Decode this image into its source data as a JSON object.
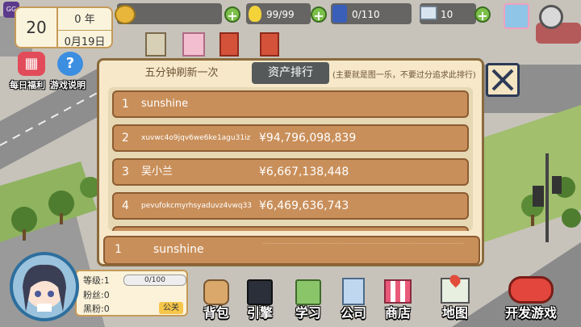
{
  "game": {
    "top_bar": {
      "money_value": "",
      "energy_value": "99/99",
      "fans_value": "0/110",
      "computers_value": "10",
      "day": "20",
      "year_label": "0 年",
      "date_label": "0月19日"
    },
    "side_buttons": {
      "daily_welfare_label": "每日福利",
      "game_help_label": "游戏说明"
    },
    "ranking_panel": {
      "tab_refresh_label": "五分钟刷新一次",
      "tab_asset_label": "资产排行",
      "note": "(主要就是图一乐，不要过分追求此排行)",
      "rows": [
        {
          "rank": "1",
          "name": "sunshine",
          "value": ""
        },
        {
          "rank": "2",
          "name": "xuvwc4o9jqv6we6ke1agu31iz",
          "value": "¥94,796,098,839"
        },
        {
          "rank": "3",
          "name": "吴小兰",
          "value": "¥6,667,138,448"
        },
        {
          "rank": "4",
          "name": "pevufokcmyrhsyaduvz4vwq33",
          "value": "¥6,469,636,743"
        }
      ],
      "self_row": {
        "rank": "1",
        "name": "sunshine"
      }
    },
    "player": {
      "level_label": "等级:1",
      "xp_label": "0/100",
      "xp_progress": 0.0,
      "fans_label": "粉丝:0",
      "haters_label": "黑粉:0",
      "pr_button_label": "公关"
    },
    "bottom_nav": [
      {
        "label": "背包",
        "icon": "backpack-icon"
      },
      {
        "label": "引擎",
        "icon": "server-icon"
      },
      {
        "label": "学习",
        "icon": "book-icon"
      },
      {
        "label": "公司",
        "icon": "building-icon"
      },
      {
        "label": "商店",
        "icon": "shop-icon"
      },
      {
        "label": "地图",
        "icon": "map-icon"
      },
      {
        "label": "开发游戏",
        "icon": "gamepad-icon"
      }
    ],
    "colors": {
      "panel_bg": "#f7e8c9",
      "row_bg": "#c98f5a",
      "tab_active_bg": "#55595a",
      "plus_green": "#7cc04a",
      "dev_button_red": "#e2463c"
    }
  }
}
